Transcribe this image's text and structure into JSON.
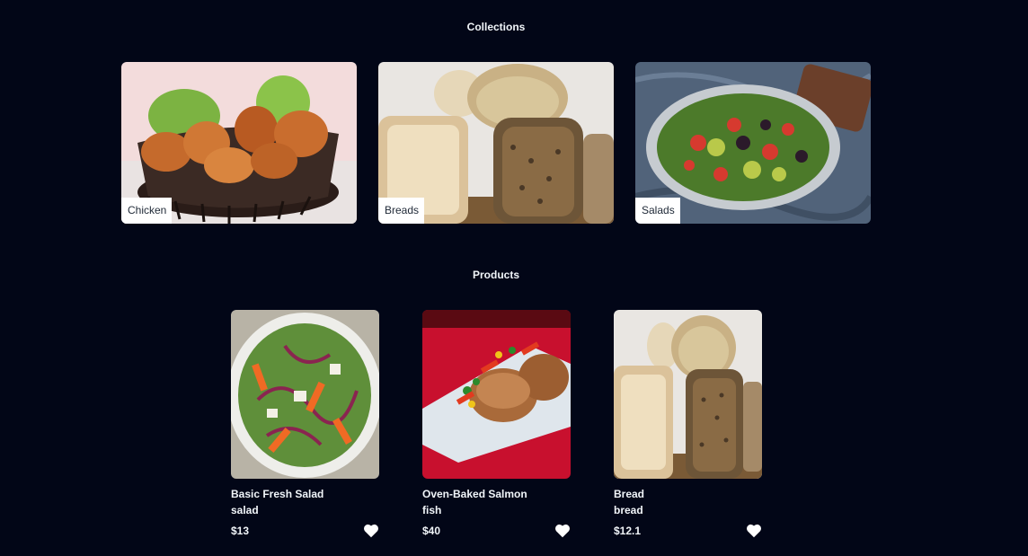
{
  "collections": {
    "title": "Collections",
    "items": [
      {
        "label": "Chicken"
      },
      {
        "label": "Breads"
      },
      {
        "label": "Salads"
      }
    ]
  },
  "products": {
    "title": "Products",
    "items": [
      {
        "name": "Basic Fresh Salad",
        "category": "salad",
        "price": "$13",
        "icon": "heart-icon"
      },
      {
        "name": "Oven-Baked Salmon",
        "category": "fish",
        "price": "$40",
        "icon": "heart-icon"
      },
      {
        "name": "Bread",
        "category": "bread",
        "price": "$12.1",
        "icon": "heart-icon"
      }
    ]
  },
  "colors": {
    "background": "#020617",
    "text": "#f1f5f9",
    "label_bg": "#ffffff"
  }
}
